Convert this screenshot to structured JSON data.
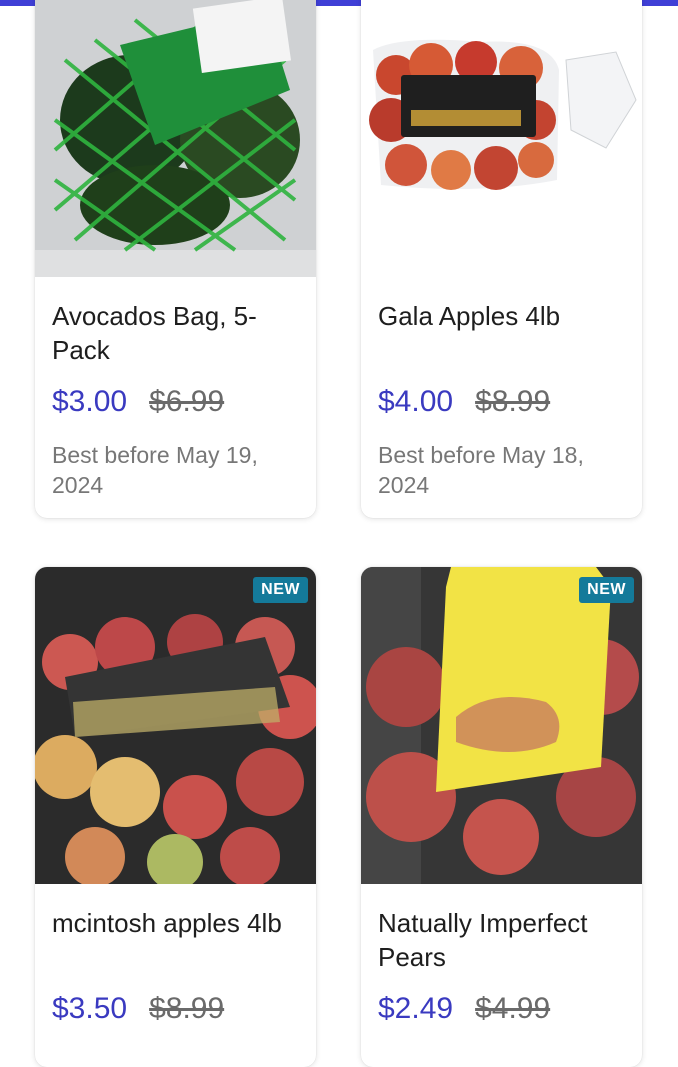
{
  "accent_color": "#3f3fd6",
  "price_color": "#3a3ac0",
  "badge_color": "#147a9a",
  "products": [
    {
      "title": "Avocados Bag, 5-Pack",
      "price": "$3.00",
      "original_price": "$6.99",
      "best_before": "Best before May 19, 2024",
      "badge": "",
      "image": "avocado-bag-image"
    },
    {
      "title": "Gala Apples 4lb",
      "price": "$4.00",
      "original_price": "$8.99",
      "best_before": "Best before May 18, 2024",
      "badge": "",
      "image": "gala-apples-image"
    },
    {
      "title": "mcintosh apples 4lb",
      "price": "$3.50",
      "original_price": "$8.99",
      "best_before": "",
      "badge": "NEW",
      "image": "mcintosh-apples-image"
    },
    {
      "title": "Natually Imperfect Pears",
      "price": "$2.49",
      "original_price": "$4.99",
      "best_before": "",
      "badge": "NEW",
      "image": "pears-bag-image"
    }
  ]
}
